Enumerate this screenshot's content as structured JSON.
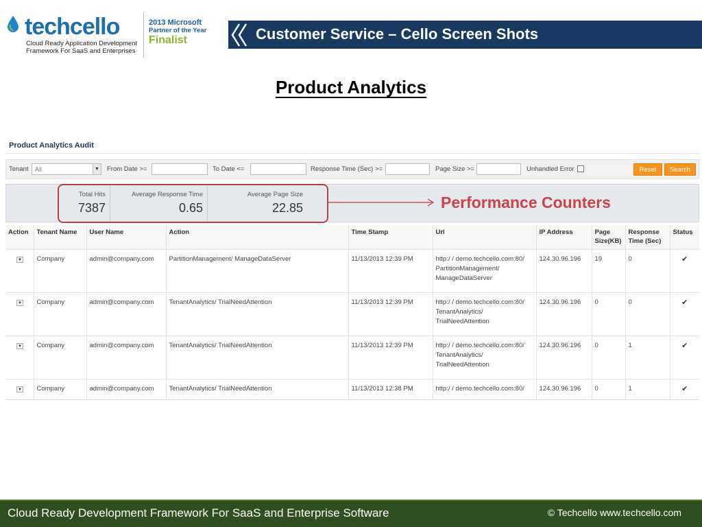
{
  "header": {
    "logo_text": "techcello",
    "logo_tagline_1": "Cloud Ready Application Development",
    "logo_tagline_2": "Framework For SaaS and Enterprises",
    "award_year": "2013 Microsoft",
    "award_partner": "Partner of the Year",
    "award_status": "Finalist",
    "banner_title": "Customer Service – Cello Screen Shots"
  },
  "page_title": "Product Analytics",
  "audit": {
    "title": "Product Analytics Audit",
    "filters": {
      "tenant_label": "Tenant",
      "tenant_value": "All",
      "from_date_label": "From Date >=",
      "to_date_label": "To Date <=",
      "response_time_label": "Response Time (Sec) >=",
      "page_size_label": "Page Size >=",
      "unhandled_error_label": "Unhandled Error",
      "reset_label": "Reset",
      "search_label": "Search"
    },
    "stats": {
      "total_hits_label": "Total Hits",
      "total_hits_value": "7387",
      "avg_response_label": "Average Response Time",
      "avg_response_value": "0.65",
      "avg_page_size_label": "Average Page Size",
      "avg_page_size_value": "22.85"
    },
    "callout": "Performance Counters",
    "columns": [
      "Action",
      "Tenant Name",
      "User Name",
      "Action",
      "Time Stamp",
      "Url",
      "IP Address",
      "Page Size(KB)",
      "Response Time (Sec)",
      "Status"
    ],
    "rows": [
      {
        "tenant": "Company",
        "user": "admin@company.com",
        "action": "PartitionManagement/ ManageDataServer",
        "timestamp": "11/13/2013 12:39 PM",
        "url": "http:/ / demo.techcello.com:80/ PartitionManagement/ ManageDataServer",
        "ip": "124.30.96.196",
        "page_size": "19",
        "response_time": "0",
        "status": "✔"
      },
      {
        "tenant": "Company",
        "user": "admin@company.com",
        "action": "TenantAnalytics/ TrialNeedAttention",
        "timestamp": "11/13/2013 12:39 PM",
        "url": "http:/ / demo.techcello.com:80/ TenantAnalytics/ TrialNeedAttention",
        "ip": "124.30.96.196",
        "page_size": "0",
        "response_time": "0",
        "status": "✔"
      },
      {
        "tenant": "Company",
        "user": "admin@company.com",
        "action": "TenantAnalytics/ TrialNeedAttention",
        "timestamp": "11/13/2013 12:39 PM",
        "url": "http:/ / demo.techcello.com:80/ TenantAnalytics/ TrialNeedAttention",
        "ip": "124.30.96.196",
        "page_size": "0",
        "response_time": "1",
        "status": "✔"
      },
      {
        "tenant": "Company",
        "user": "admin@company.com",
        "action": "TenantAnalytics/ TrialNeedAttention",
        "timestamp": "11/13/2013 12:38 PM",
        "url": "http:/ / demo.techcello.com:80/",
        "ip": "124.30.96.196",
        "page_size": "0",
        "response_time": "1",
        "status": "✔"
      }
    ]
  },
  "footer": {
    "left": "Cloud Ready Development Framework For SaaS and Enterprise Software",
    "right": "© Techcello www.techcello.com"
  },
  "colors": {
    "banner": "#173a60",
    "footer": "#2f4f1f",
    "button": "#f7931e",
    "callout": "#c9444a"
  }
}
